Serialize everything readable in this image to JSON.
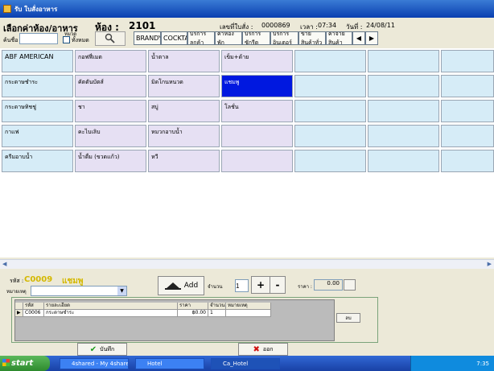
{
  "window": {
    "title": "รับ ใบสั่งอาหาร"
  },
  "header": {
    "section_title": "เลือกค่าห้อง/อาหาร",
    "room_label": "ห้อง :",
    "room_number": "2101",
    "doc_no_label": "เลขที่ใบสั่ง :",
    "doc_no": "0000869",
    "time_label": "เวลา :",
    "time": "07:34",
    "date_label": "วันที่ :",
    "date": "24/08/11",
    "search_label": "ค้นชื่อ",
    "search_value": "",
    "category_label": "หมวด",
    "all_label": "ทั้งหมด"
  },
  "category_tabs": [
    "BRANDY",
    "COCKTA",
    "บริการลูกค้า",
    "ค่าห้องพัก",
    "บริการซักรีด",
    "บริการอินเตอร์",
    "ขายสินค้าทั่ว",
    "ค่าจ่ายสินค้า"
  ],
  "items": [
    [
      "ABF AMERICAN",
      "กอฟฟี่เมต",
      "น้ำตาล",
      "เข็ม+ด้าย",
      "",
      "",
      ""
    ],
    [
      "กระดาษชำระ",
      "คัตตันบัตส์",
      "มิดโกนหนวด",
      "แชมพู",
      "",
      "",
      ""
    ],
    [
      "กระดาษทิชชู่",
      "ชา",
      "สบู่",
      "โลชั่น",
      "",
      "",
      ""
    ],
    [
      "กาแฟ",
      "คะไบเลิบ",
      "หมวกอาบน้ำ",
      "",
      "",
      "",
      ""
    ],
    [
      "ครีมอาบน้ำ",
      "น้ำดื่ม (ขวดแก้ว)",
      "หวี",
      "",
      "",
      "",
      ""
    ]
  ],
  "detail": {
    "code_label": "รหัส :",
    "code": "C0009",
    "name": "แชมพู",
    "note_label": "หมายเหตุ",
    "note_value": "",
    "add_label": "Add",
    "qty_label": "จำนวน",
    "qty": "1",
    "plus": "+",
    "minus": "-",
    "price_label": "ราคา :",
    "price": "0.00"
  },
  "order_table": {
    "headers": [
      "รหัส",
      "รายละเอียด",
      "ราคา",
      "จำนวน",
      "หมายเหตุ"
    ],
    "rows": [
      [
        "C0006",
        "กระดาษชำระ",
        "฿0.00",
        "1",
        ""
      ]
    ]
  },
  "buttons": {
    "delete": "ลบ",
    "save": "บันทึก",
    "cancel": "ออก"
  },
  "taskbar": {
    "start": "start",
    "tasks": [
      "4shared - My 4share...",
      "Hotel",
      "Ca_Hotel"
    ],
    "clock": "7:35"
  }
}
